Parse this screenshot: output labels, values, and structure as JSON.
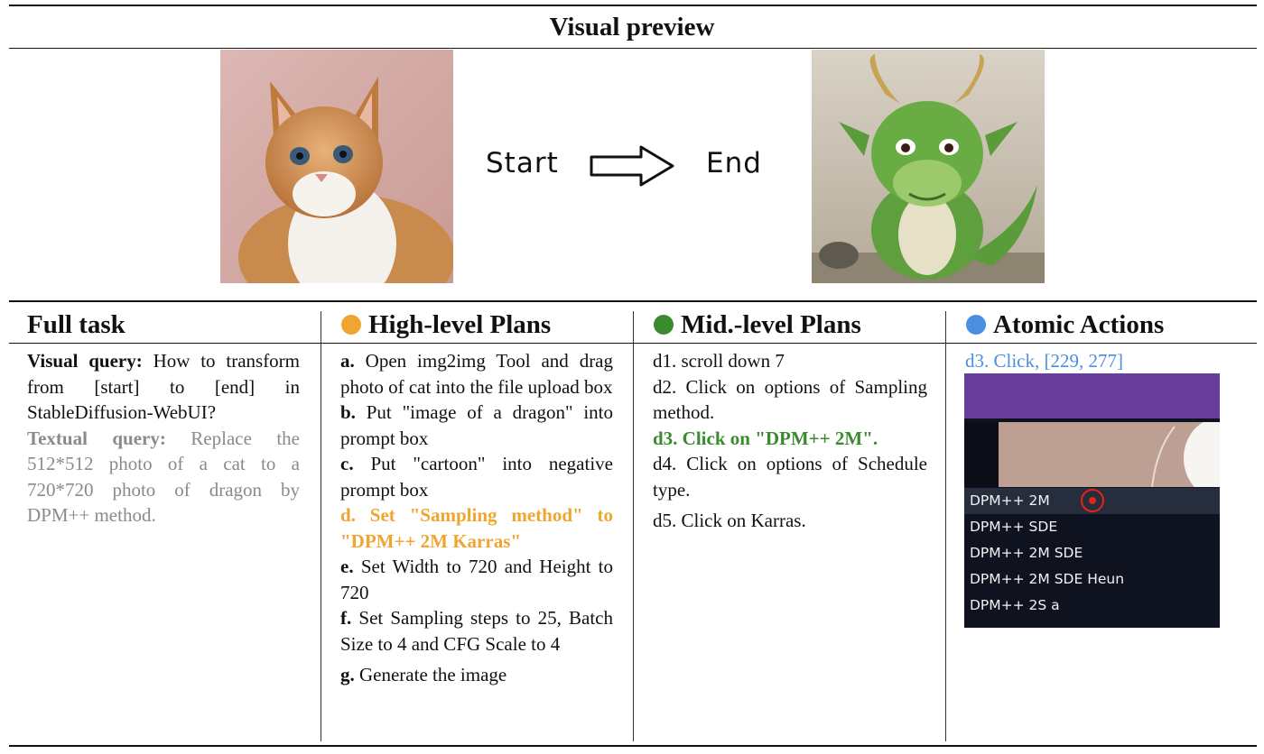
{
  "preview": {
    "title": "Visual preview",
    "start_label": "Start",
    "end_label": "End",
    "start_image": "cat-photo",
    "end_image": "dragon-photo",
    "arrow_icon": "right-arrow-icon"
  },
  "columns": {
    "full_task": {
      "title": "Full task"
    },
    "high_level": {
      "title": "High-level Plans",
      "dot_color": "#f0a530"
    },
    "mid_level": {
      "title": "Mid.-level Plans",
      "dot_color": "#3a8a2e"
    },
    "atomic": {
      "title": "Atomic Actions",
      "dot_color": "#4a8fe2"
    }
  },
  "full_task": {
    "visual_label": "Visual query:",
    "visual_text": "How to transform from [start] to [end] in StableDiffusion-WebUI?",
    "textual_label": "Textual query:",
    "textual_text": "Replace the 512*512 photo of a cat to a 720*720 photo of dragon by DPM++ method."
  },
  "high_level": [
    {
      "key": "a.",
      "text": "Open img2img Tool and drag photo of cat into the file upload box"
    },
    {
      "key": "b.",
      "text": "Put \"image of a dragon\" into prompt box"
    },
    {
      "key": "c.",
      "text": "Put \"cartoon\" into negative prompt box"
    },
    {
      "key": "d.",
      "text": "Set \"Sampling method\" to \"DPM++ 2M Karras\""
    },
    {
      "key": "e.",
      "text": "Set Width to 720 and Height to 720"
    },
    {
      "key": "f.",
      "text": "Set Sampling steps to 25, Batch Size to 4 and CFG Scale to 4"
    },
    {
      "key": "g.",
      "text": "Generate the image"
    }
  ],
  "mid_level": [
    "d1. scroll down 7",
    "d2. Click on options of Sampling method.",
    "d3. Click on \"DPM++ 2M\".",
    "d4. Click on options of Schedule type.",
    "d5. Click on Karras."
  ],
  "atomic": {
    "action": "d3. Click, [229, 277]",
    "options": [
      "DPM++ 2M",
      "DPM++ SDE",
      "DPM++ 2M SDE",
      "DPM++ 2M SDE Heun",
      "DPM++ 2S a"
    ],
    "selected": "DPM++ 2M",
    "accent_color": "#673e9c",
    "marker_color": "#e2231a"
  }
}
